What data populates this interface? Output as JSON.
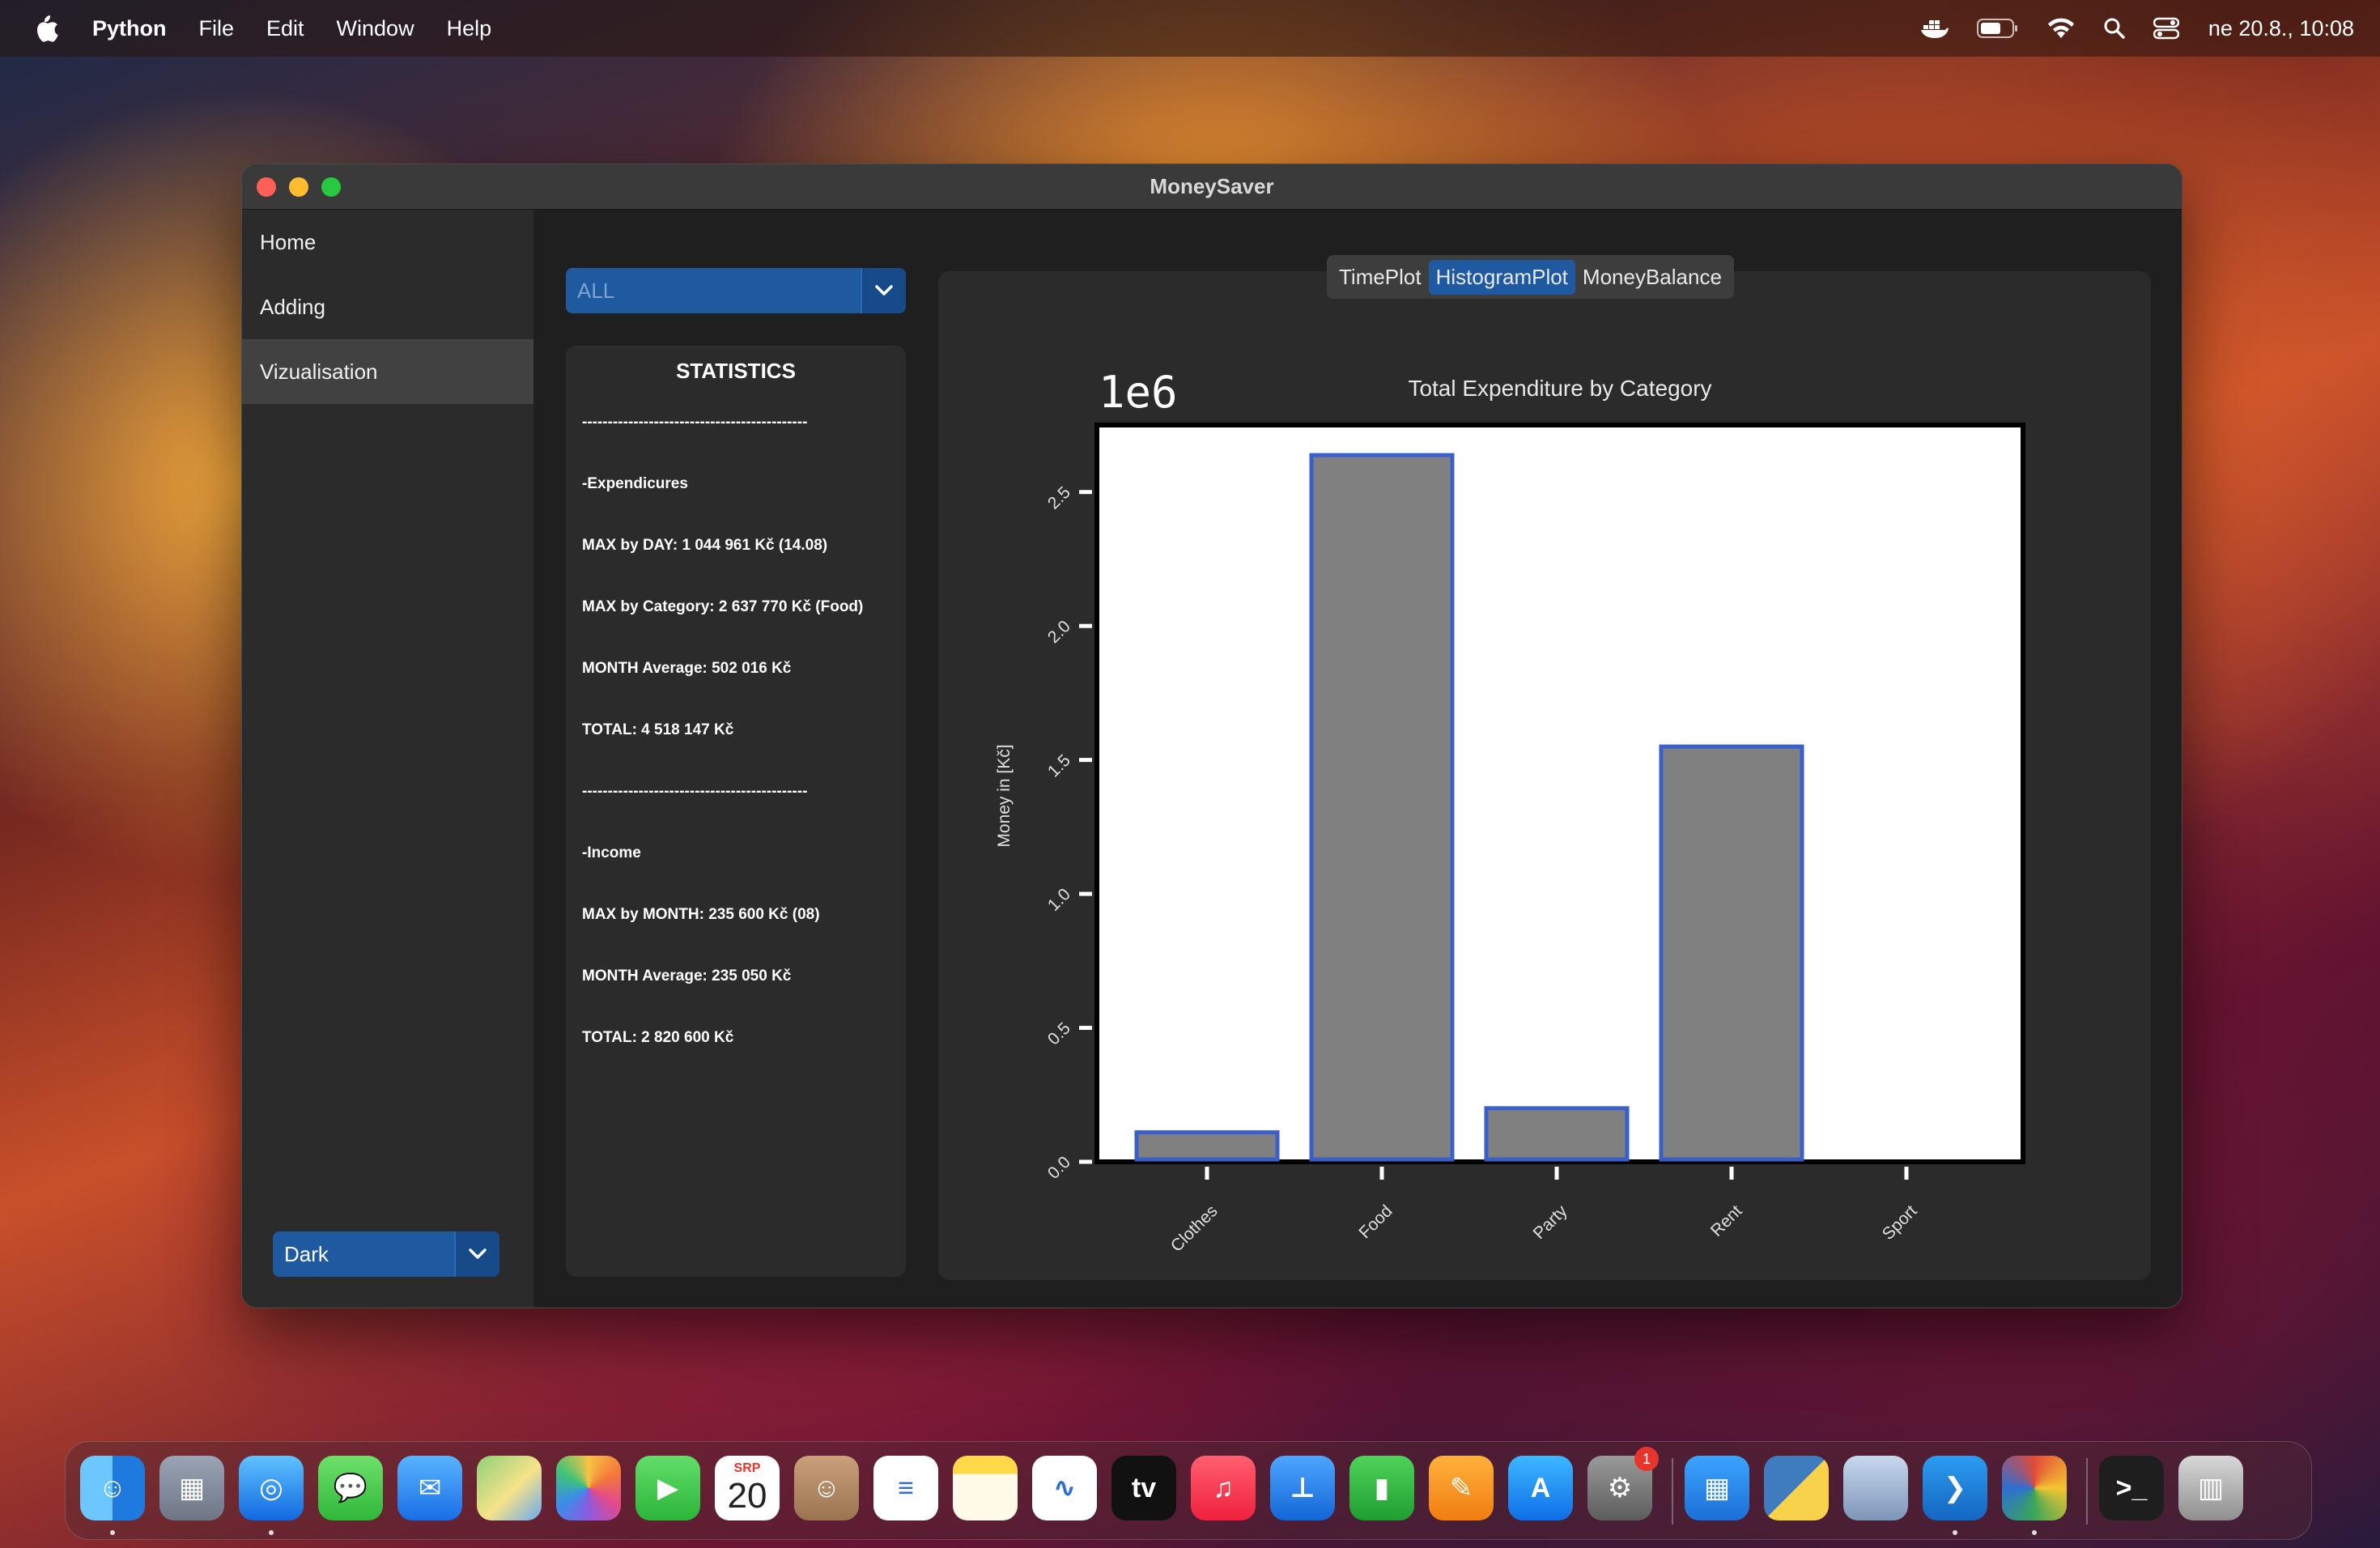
{
  "menubar": {
    "app_name": "Python",
    "items": [
      "File",
      "Edit",
      "Window",
      "Help"
    ],
    "clock": "ne 20.8., 10:08"
  },
  "window": {
    "title": "MoneySaver"
  },
  "sidebar": {
    "items": [
      {
        "label": "Home"
      },
      {
        "label": "Adding"
      },
      {
        "label": "Vizualisation"
      }
    ],
    "active": "Vizualisation",
    "theme_select": {
      "value": "Dark"
    }
  },
  "filter_select": {
    "value": "ALL"
  },
  "statistics": {
    "heading": "STATISTICS",
    "lines": [
      "--------------------------------------------",
      "-Expendicures",
      "MAX by DAY: 1 044 961 Kč (14.08)",
      "MAX by Category: 2 637 770 Kč (Food)",
      "MONTH Average: 502 016 Kč",
      "TOTAL: 4 518 147 Kč",
      "--------------------------------------------",
      "-Income",
      "MAX by MONTH: 235 600 Kč (08)",
      "MONTH Average: 235 050 Kč",
      "TOTAL: 2 820 600 Kč"
    ]
  },
  "plot_tabs": {
    "items": [
      "TimePlot",
      "HistogramPlot",
      "MoneyBalance"
    ],
    "active": "HistogramPlot"
  },
  "chart_data": {
    "type": "bar",
    "title": "Total Expenditure by Category",
    "ylabel": "Money in [Kč]",
    "xlabel": "",
    "offset_label": "1e6",
    "categories": [
      "Clothes",
      "Food",
      "Party",
      "Rent",
      "Sport"
    ],
    "values": [
      0.11,
      2.63777,
      0.2,
      1.55,
      0.0
    ],
    "ylim": [
      0,
      2.75
    ],
    "yticks": [
      "0.0",
      "0.5",
      "1.0",
      "1.5",
      "2.0",
      "2.5"
    ],
    "bar_color": "#808080",
    "edge_color": "#3a5fc8",
    "grid": false
  },
  "dock": {
    "calendar_month": "SRP",
    "calendar_day": "20",
    "settings_badge": "1",
    "apps": [
      "finder-icon",
      "launchpad-icon",
      "safari-icon",
      "messages-icon",
      "mail-icon",
      "maps-icon",
      "photos-icon",
      "facetime-icon",
      "calendar-icon",
      "contacts-icon",
      "reminders-icon",
      "notes-icon",
      "freeform-icon",
      "tv-icon",
      "music-icon",
      "keynote-icon",
      "numbers-icon",
      "pages-icon",
      "app-store-icon",
      "system-settings-icon",
      "docker-icon",
      "python-launcher-icon",
      "preview-icon",
      "vscode-icon",
      "pinwheel-icon",
      "terminal-icon",
      "trash-icon"
    ]
  }
}
